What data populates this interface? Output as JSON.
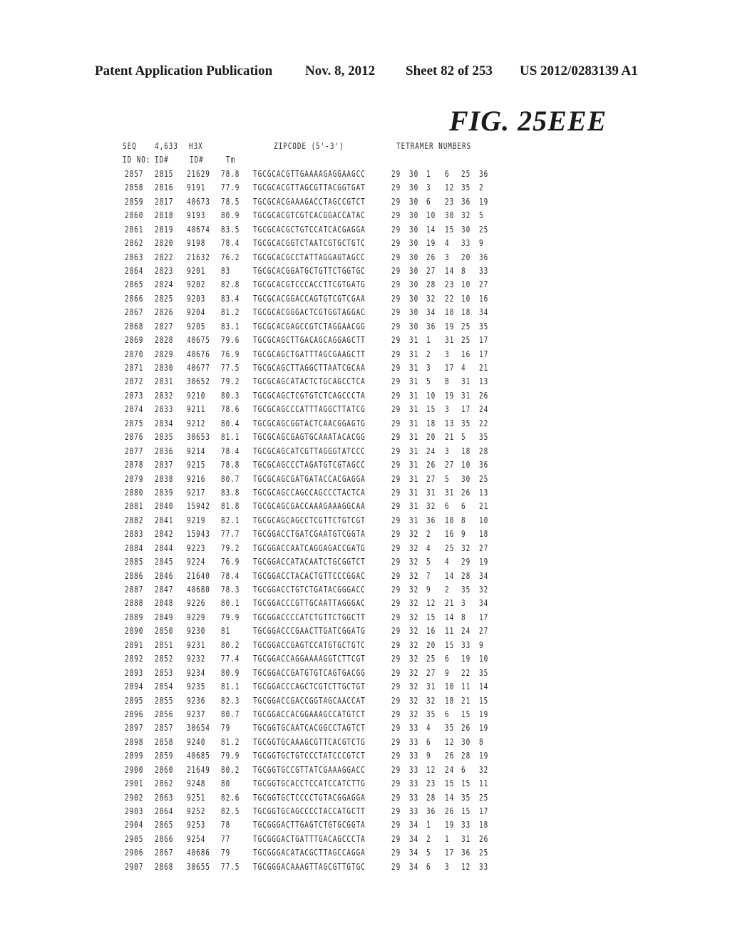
{
  "header": {
    "publication": "Patent Application Publication",
    "date": "Nov. 8, 2012",
    "sheet": "Sheet 82 of 253",
    "patent_number": "US 2012/0283139 A1"
  },
  "figure_label": "FIG. 25EEE",
  "table": {
    "header_line1": [
      "SEQ",
      "4,633",
      "H3X",
      "ZIPCODE (5'-3')",
      "TETRAMER NUMBERS"
    ],
    "header_line2": [
      "ID NO:",
      "ID#",
      "ID#",
      "Tm"
    ],
    "rows": [
      [
        "2857",
        "2815",
        "21629",
        "78.8",
        "TGCGCACGTTGAAAAGAGGAAGCC",
        "29",
        "30",
        "1",
        "6",
        "25",
        "36"
      ],
      [
        "2858",
        "2816",
        "9191",
        "77.9",
        "TGCGCACGTTAGCGTTACGGTGAT",
        "29",
        "30",
        "3",
        "12",
        "35",
        "2"
      ],
      [
        "2859",
        "2817",
        "40673",
        "78.5",
        "TGCGCACGAAAGACCTAGCCGTCT",
        "29",
        "30",
        "6",
        "23",
        "36",
        "19"
      ],
      [
        "2860",
        "2818",
        "9193",
        "80.9",
        "TGCGCACGTCGTCACGGACCATAC",
        "29",
        "30",
        "10",
        "30",
        "32",
        "5"
      ],
      [
        "2861",
        "2819",
        "40674",
        "83.5",
        "TGCGCACGCTGTCCATCACGAGGA",
        "29",
        "30",
        "14",
        "15",
        "30",
        "25"
      ],
      [
        "2862",
        "2820",
        "9198",
        "78.4",
        "TGCGCACGGTCTAATCGTGCTGTC",
        "29",
        "30",
        "19",
        "4",
        "33",
        "9"
      ],
      [
        "2863",
        "2822",
        "21632",
        "76.2",
        "TGCGCACGCCTATTAGGAGTAGCC",
        "29",
        "30",
        "26",
        "3",
        "20",
        "36"
      ],
      [
        "2864",
        "2823",
        "9201",
        "83",
        "TGCGCACGGATGCTGTTCTGGTGC",
        "29",
        "30",
        "27",
        "14",
        "8",
        "33"
      ],
      [
        "2865",
        "2824",
        "9202",
        "82.8",
        "TGCGCACGTCCCACCTTCGTGATG",
        "29",
        "30",
        "28",
        "23",
        "10",
        "27"
      ],
      [
        "2866",
        "2825",
        "9203",
        "83.4",
        "TGCGCACGGACCAGTGTCGTCGAA",
        "29",
        "30",
        "32",
        "22",
        "10",
        "16"
      ],
      [
        "2867",
        "2826",
        "9204",
        "81.2",
        "TGCGCACGGGACTCGTGGTAGGAC",
        "29",
        "30",
        "34",
        "10",
        "18",
        "34"
      ],
      [
        "2868",
        "2827",
        "9205",
        "83.1",
        "TGCGCACGAGCCGTCTAGGAACGG",
        "29",
        "30",
        "36",
        "19",
        "25",
        "35"
      ],
      [
        "2869",
        "2828",
        "40675",
        "79.6",
        "TGCGCAGCTTGACAGCAGGAGCTT",
        "29",
        "31",
        "1",
        "31",
        "25",
        "17"
      ],
      [
        "2870",
        "2829",
        "40676",
        "76.9",
        "TGCGCAGCTGATTTAGCGAAGCTT",
        "29",
        "31",
        "2",
        "3",
        "16",
        "17"
      ],
      [
        "2871",
        "2830",
        "40677",
        "77.5",
        "TGCGCAGCTTAGGCTTAATCGCAA",
        "29",
        "31",
        "3",
        "17",
        "4",
        "21"
      ],
      [
        "2872",
        "2831",
        "30652",
        "79.2",
        "TGCGCAGCATACTCTGCAGCCTCA",
        "29",
        "31",
        "5",
        "8",
        "31",
        "13"
      ],
      [
        "2873",
        "2832",
        "9210",
        "80.3",
        "TGCGCAGCTCGTGTCTCAGCCCTA",
        "29",
        "31",
        "10",
        "19",
        "31",
        "26"
      ],
      [
        "2874",
        "2833",
        "9211",
        "78.6",
        "TGCGCAGCCCATTTAGGCTTATCG",
        "29",
        "31",
        "15",
        "3",
        "17",
        "24"
      ],
      [
        "2875",
        "2834",
        "9212",
        "80.4",
        "TGCGCAGCGGTACTCAACGGAGTG",
        "29",
        "31",
        "18",
        "13",
        "35",
        "22"
      ],
      [
        "2876",
        "2835",
        "30653",
        "81.1",
        "TGCGCAGCGAGTGCAAATACACGG",
        "29",
        "31",
        "20",
        "21",
        "5",
        "35"
      ],
      [
        "2877",
        "2836",
        "9214",
        "78.4",
        "TGCGCAGCATCGTTAGGGTATCCC",
        "29",
        "31",
        "24",
        "3",
        "18",
        "28"
      ],
      [
        "2878",
        "2837",
        "9215",
        "78.8",
        "TGCGCAGCCCTAGATGTCGTAGCC",
        "29",
        "31",
        "26",
        "27",
        "10",
        "36"
      ],
      [
        "2879",
        "2838",
        "9216",
        "80.7",
        "TGCGCAGCGATGATACCACGAGGA",
        "29",
        "31",
        "27",
        "5",
        "30",
        "25"
      ],
      [
        "2880",
        "2839",
        "9217",
        "83.8",
        "TGCGCAGCCAGCCAGCCCTACTCA",
        "29",
        "31",
        "31",
        "31",
        "26",
        "13"
      ],
      [
        "2881",
        "2840",
        "15942",
        "81.8",
        "TGCGCAGCGACCAAAGAAAGGCAA",
        "29",
        "31",
        "32",
        "6",
        "6",
        "21"
      ],
      [
        "2882",
        "2841",
        "9219",
        "82.1",
        "TGCGCAGCAGCCTCGTTCTGTCGT",
        "29",
        "31",
        "36",
        "10",
        "8",
        "10"
      ],
      [
        "2883",
        "2842",
        "15943",
        "77.7",
        "TGCGGACCTGATCGAATGTCGGTA",
        "29",
        "32",
        "2",
        "16",
        "9",
        "18"
      ],
      [
        "2884",
        "2844",
        "9223",
        "79.2",
        "TGCGGACCAATCAGGAGACCGATG",
        "29",
        "32",
        "4",
        "25",
        "32",
        "27"
      ],
      [
        "2885",
        "2845",
        "9224",
        "76.9",
        "TGCGGACCATACAATCTGCGGTCT",
        "29",
        "32",
        "5",
        "4",
        "29",
        "19"
      ],
      [
        "2886",
        "2846",
        "21640",
        "78.4",
        "TGCGGACCTACACTGTTCCCGGAC",
        "29",
        "32",
        "7",
        "14",
        "28",
        "34"
      ],
      [
        "2887",
        "2847",
        "40680",
        "78.3",
        "TGCGGACCTGTCTGATACGGGACC",
        "29",
        "32",
        "9",
        "2",
        "35",
        "32"
      ],
      [
        "2888",
        "2848",
        "9226",
        "80.1",
        "TGCGGACCCGTTGCAATTAGGGAC",
        "29",
        "32",
        "12",
        "21",
        "3",
        "34"
      ],
      [
        "2889",
        "2849",
        "9229",
        "79.9",
        "TGCGGACCCCATCTGTTCTGGCTT",
        "29",
        "32",
        "15",
        "14",
        "8",
        "17"
      ],
      [
        "2890",
        "2850",
        "9230",
        "81",
        "TGCGGACCCGAACTTGATCGGATG",
        "29",
        "32",
        "16",
        "11",
        "24",
        "27"
      ],
      [
        "2891",
        "2851",
        "9231",
        "80.2",
        "TGCGGACCGAGTCCATGTGCTGTC",
        "29",
        "32",
        "20",
        "15",
        "33",
        "9"
      ],
      [
        "2892",
        "2852",
        "9232",
        "77.4",
        "TGCGGACCAGGAAAAGGTCTTCGT",
        "29",
        "32",
        "25",
        "6",
        "19",
        "10"
      ],
      [
        "2893",
        "2853",
        "9234",
        "80.9",
        "TGCGGACCGATGTGTCAGTGACGG",
        "29",
        "32",
        "27",
        "9",
        "22",
        "35"
      ],
      [
        "2894",
        "2854",
        "9235",
        "81.1",
        "TGCGGACCCAGCTCGTCTTGCTGT",
        "29",
        "32",
        "31",
        "10",
        "11",
        "14"
      ],
      [
        "2895",
        "2855",
        "9236",
        "82.3",
        "TGCGGACCGACCGGTAGCAACCAT",
        "29",
        "32",
        "32",
        "18",
        "21",
        "15"
      ],
      [
        "2896",
        "2856",
        "9237",
        "80.7",
        "TGCGGACCACGGAAAGCCATGTCT",
        "29",
        "32",
        "35",
        "6",
        "15",
        "19"
      ],
      [
        "2897",
        "2857",
        "30654",
        "79",
        "TGCGGTGCAATCACGGCCTAGTCT",
        "29",
        "33",
        "4",
        "35",
        "26",
        "19"
      ],
      [
        "2898",
        "2858",
        "9240",
        "81.2",
        "TGCGGTGCAAAGCGTTCACGTCTG",
        "29",
        "33",
        "6",
        "12",
        "30",
        "8"
      ],
      [
        "2899",
        "2859",
        "40685",
        "79.9",
        "TGCGGTGCTGTCCCTATCCCGTCT",
        "29",
        "33",
        "9",
        "26",
        "28",
        "19"
      ],
      [
        "2900",
        "2860",
        "21649",
        "80.2",
        "TGCGGTGCCGTTATCGAAAGGACC",
        "29",
        "33",
        "12",
        "24",
        "6",
        "32"
      ],
      [
        "2901",
        "2862",
        "9248",
        "80",
        "TGCGGTGCACCTCCATCCATCTTG",
        "29",
        "33",
        "23",
        "15",
        "15",
        "11"
      ],
      [
        "2902",
        "2863",
        "9251",
        "82.6",
        "TGCGGTGCTCCCCTGTACGGAGGA",
        "29",
        "33",
        "28",
        "14",
        "35",
        "25"
      ],
      [
        "2903",
        "2864",
        "9252",
        "82.5",
        "TGCGGTGCAGCCCCTACCATGCTT",
        "29",
        "33",
        "36",
        "26",
        "15",
        "17"
      ],
      [
        "2904",
        "2865",
        "9253",
        "78",
        "TGCGGGACTTGAGTCTGTGCGGTA",
        "29",
        "34",
        "1",
        "19",
        "33",
        "18"
      ],
      [
        "2905",
        "2866",
        "9254",
        "77",
        "TGCGGGACTGATTTGACAGCCCTA",
        "29",
        "34",
        "2",
        "1",
        "31",
        "26"
      ],
      [
        "2906",
        "2867",
        "40686",
        "79",
        "TGCGGGACATACGCTTAGCCAGGA",
        "29",
        "34",
        "5",
        "17",
        "36",
        "25"
      ],
      [
        "2907",
        "2868",
        "30655",
        "77.5",
        "TGCGGGACAAAGTTAGCGTTGTGC",
        "29",
        "34",
        "6",
        "3",
        "12",
        "33"
      ]
    ]
  }
}
